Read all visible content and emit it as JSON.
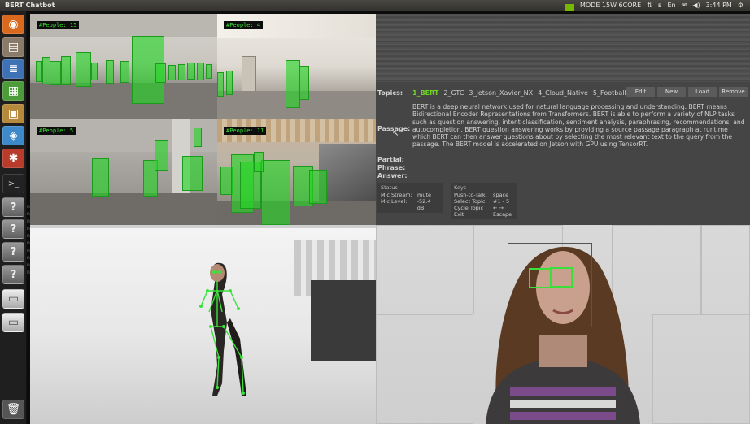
{
  "window": {
    "title": "BERT Chatbot"
  },
  "system_bar": {
    "mode": "MODE 15W 6CORE",
    "volume": "◀)",
    "time": "3:44 PM"
  },
  "cameras": [
    {
      "label": "#People: 15"
    },
    {
      "label": "#People: 4"
    },
    {
      "label": "#People: 5"
    },
    {
      "label": "#People: 11"
    }
  ],
  "bert": {
    "topics_label": "Topics:",
    "topics": [
      "1_BERT",
      "2_GTC",
      "3_Jetson_Xavier_NX",
      "4_Cloud_Native",
      "5_Football"
    ],
    "buttons": {
      "edit": "Edit",
      "new": "New",
      "load": "Load",
      "remove": "Remove"
    },
    "passage_label": "Passage:",
    "passage": "BERT is a deep neural network used for natural language processing and understanding.  BERT means Bidirectional Encoder Representations from Transformers.  BERT is able to perform a variety of NLP tasks such as question answering, intent classification, sentiment analysis, paraphrasing, recommendations, and autocompletion.  BERT question answering works by providing a source passage paragraph at runtime which BERT can then answer questions about by selecting the most relevant text to the query from the passage.  The BERT model is accelerated on Jetson with GPU using TensorRT.",
    "partial_label": "Partial:",
    "phrase_label": "Phrase:",
    "answer_label": "Answer:",
    "status": {
      "header": "Status",
      "rows": [
        {
          "k": "Mic Stream:",
          "v": "mute"
        },
        {
          "k": "Mic Level:",
          "v": "-52.4 dB"
        }
      ]
    },
    "keys": {
      "header": "Keys",
      "rows": [
        {
          "k": "Push-to-Talk",
          "v": "space"
        },
        {
          "k": "Select Topic",
          "v": "#1 - 5"
        },
        {
          "k": "Cycle Topic",
          "v": "← →"
        },
        {
          "k": "Exit",
          "v": "Escape"
        }
      ]
    }
  }
}
